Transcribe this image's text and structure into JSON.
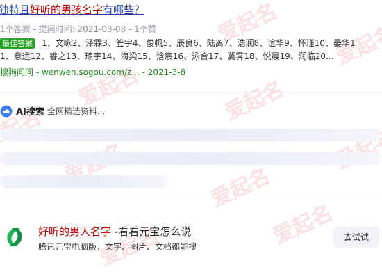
{
  "result": {
    "title_prefix": "独特且",
    "title_highlight": "好听的男孩名字",
    "title_suffix": "有哪些？",
    "meta": "1个答案 - 提问时间: 2021-03-08 - 1个赞",
    "badge": "最佳答案",
    "answer_line1": "1、文咏2、泽霖3、笠宇4、俊帆5、辰良6、陆离7、浩润8、谊华9、怀瑾10、晏华1",
    "answer_line2": "1、意远12、睿之13、琼宇14、海梁15、浛宸16、泳合17、冀霁18、悦晨19、润临20...",
    "source": "搜狗问问 - wenwen.sogou.com/z... - 2021-3-8"
  },
  "ai": {
    "label": "AI搜索",
    "sub": "全网精选资料..."
  },
  "yuanbao": {
    "title_highlight": "好听的男人名字",
    "title_suffix": " -看看元宝怎么说",
    "subtitle": "腾讯元宝电脑版，文字、图片、文档都能搜",
    "button": "去试试"
  },
  "watermark": {
    "text": "爱起名",
    "color": "#eb7882"
  }
}
